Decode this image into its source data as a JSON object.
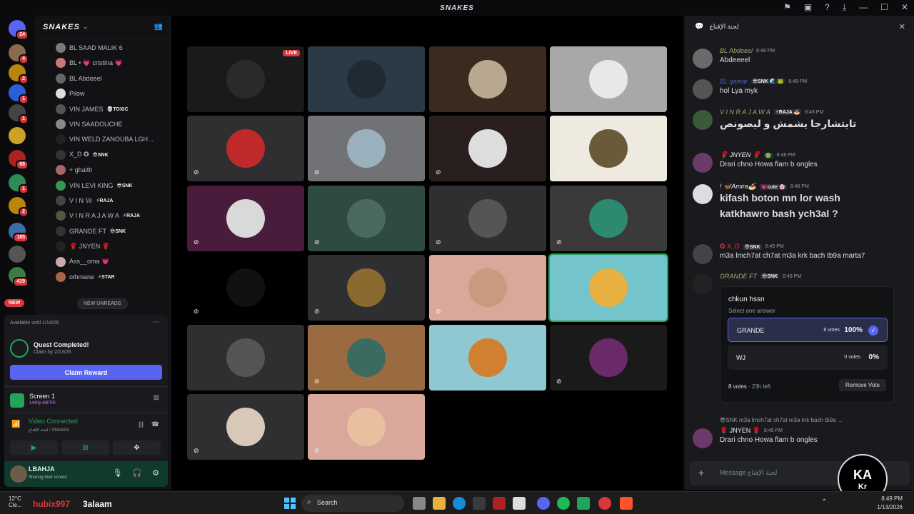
{
  "window": {
    "title": "SNAKES",
    "controls": [
      "flag-icon",
      "inbox-icon",
      "help-icon",
      "download-icon",
      "minimize-icon",
      "maximize-icon",
      "close-icon"
    ]
  },
  "rail": {
    "servers": [
      {
        "badge": "24",
        "color": "#5865f2"
      },
      {
        "badge": "4",
        "color": "#8a6b4f"
      },
      {
        "badge": "2",
        "color": "#b8860b"
      },
      {
        "badge": "1",
        "color": "#2b5fd9"
      },
      {
        "badge": "1",
        "color": "#444444"
      },
      {
        "badge": "",
        "color": "#c9a227"
      },
      {
        "badge": "68",
        "color": "#aa2222"
      },
      {
        "badge": "1",
        "color": "#2e8b57"
      },
      {
        "badge": "2",
        "color": "#b8860b"
      },
      {
        "badge": "185",
        "color": "#3a6ea5"
      },
      {
        "badge": "",
        "color": "#555555"
      },
      {
        "badge": "419",
        "color": "#3a7d44"
      }
    ],
    "new_label": "NEW"
  },
  "sidebar": {
    "server_name": "SNAKES",
    "members": [
      {
        "name": "BL SAAD MALIK 6",
        "tag": "",
        "color": "#7a7a7a"
      },
      {
        "name": "BL • 💗 cristina 💗",
        "tag": "",
        "color": "#c77"
      },
      {
        "name": "BL Abdeeel",
        "tag": "",
        "color": "#666"
      },
      {
        "name": "Pilow",
        "tag": "",
        "color": "#ddd"
      },
      {
        "name": "VIN JAMES",
        "tag": "💀TOXIC",
        "color": "#555"
      },
      {
        "name": "VIN SAADOUCHE",
        "tag": "",
        "color": "#888"
      },
      {
        "name": "VIN WELD ZANOUBA LGH...",
        "tag": "",
        "color": "#222"
      },
      {
        "name": "X_D ✪",
        "tag": "😎SNK",
        "color": "#333"
      },
      {
        "name": "+ ghaith",
        "tag": "",
        "color": "#a66"
      },
      {
        "name": "VIN LEVI KING",
        "tag": "😎SNK",
        "color": "#395"
      },
      {
        "name": "V I N 𝕎",
        "tag": "⚡RAJA",
        "color": "#444"
      },
      {
        "name": "V I N R A J A W A",
        "tag": "⚡RAJA",
        "color": "#554"
      },
      {
        "name": "GRANDE FT",
        "tag": "😎SNK",
        "color": "#333"
      },
      {
        "name": "🌹 JNYEN 🌹",
        "tag": "",
        "color": "#222"
      },
      {
        "name": "Ass__oma 💗",
        "tag": "",
        "color": "#caa"
      },
      {
        "name": "othmane",
        "tag": "⚡STAR",
        "color": "#a64"
      }
    ],
    "new_unreads": "NEW UNREADS",
    "quest": {
      "available": "Available until 1/14/26",
      "title": "Quest Completed!",
      "claim_by": "Claim by 2/13/26",
      "button": "Claim Reward"
    },
    "stream": {
      "name": "Screen 1",
      "quality": "1440p 60FPS"
    },
    "voice": {
      "status": "Video Connected",
      "channel": "لجنة الإقناع / SNAKES"
    },
    "user": {
      "name": "LBAHJA",
      "status": "Sharing their screen"
    }
  },
  "stage": {
    "live_label": "LIVE",
    "tiles": [
      {
        "bg": "#1a1a1a",
        "face": "#2a2a2a",
        "muted": false,
        "live": true
      },
      {
        "bg": "#2b3a45",
        "face": "#1f2a33",
        "muted": false,
        "live": false
      },
      {
        "bg": "#3a2a20",
        "face": "#b8a890",
        "muted": false,
        "live": false
      },
      {
        "bg": "#a8a8a8",
        "face": "#e8e8e8",
        "muted": false,
        "live": false
      },
      {
        "bg": "#2f2f31",
        "face": "#c02a2a",
        "muted": true,
        "live": false
      },
      {
        "bg": "#717276",
        "face": "#9bb0bd",
        "muted": true,
        "live": false
      },
      {
        "bg": "#2a1f1f",
        "face": "#dddddd",
        "muted": true,
        "live": false
      },
      {
        "bg": "#efeae0",
        "face": "#6b5a3a",
        "muted": true,
        "live": false
      },
      {
        "bg": "#4a1c3c",
        "face": "#d9d9d9",
        "muted": true,
        "live": false
      },
      {
        "bg": "#2f4a40",
        "face": "#4a6a60",
        "muted": true,
        "live": false
      },
      {
        "bg": "#2f2f31",
        "face": "#555555",
        "muted": true,
        "live": false
      },
      {
        "bg": "#3a3a3a",
        "face": "#2d8a70",
        "muted": true,
        "live": false
      },
      {
        "bg": "#000000",
        "face": "#111111",
        "muted": true,
        "live": false
      },
      {
        "bg": "#2f2f31",
        "face": "#8a6a30",
        "muted": true,
        "live": false
      },
      {
        "bg": "#d9a89a",
        "face": "#c89a80",
        "muted": true,
        "live": false
      },
      {
        "bg": "#74c4cc",
        "face": "#e8b040",
        "muted": false,
        "live": false
      },
      {
        "bg": "#2f2f31",
        "face": "#555555",
        "muted": false,
        "live": false
      },
      {
        "bg": "#9a6a40",
        "face": "#3a6a60",
        "muted": true,
        "live": false
      },
      {
        "bg": "#8fc8d0",
        "face": "#d08030",
        "muted": false,
        "live": false
      },
      {
        "bg": "#1a1a1a",
        "face": "#6a2a6a",
        "muted": true,
        "live": false
      },
      {
        "bg": "#2f2f31",
        "face": "#d8c8b8",
        "muted": true,
        "live": false
      },
      {
        "bg": "#d9a89a",
        "face": "#e8c0a0",
        "muted": true,
        "live": false
      }
    ]
  },
  "chat": {
    "title": "لجنة الإقناع",
    "messages": [
      {
        "author": "BL Abdeeel",
        "author_color": "#a3a670",
        "tag": "",
        "time": "8:48 PM",
        "text": "Abdeeeel",
        "avatar": "#6a6a6a",
        "big": false
      },
      {
        "author": "BL qamar",
        "author_color": "#4f5fbf",
        "tag": "😎SNK 🌊 🐸",
        "time": "8:48 PM",
        "text": "hol Lya myk",
        "avatar": "#555",
        "big": false
      },
      {
        "author": "V I N R A J A W A",
        "author_color": "#a3a670",
        "tag": "⚡RAJA 🍝",
        "time": "8:48 PM",
        "text": "تايتشارجا يشمش و ليصونص",
        "avatar": "#3a5a3a",
        "big": true
      },
      {
        "author": "🌹 JNYEN 🌹",
        "author_color": "#f2f3f5",
        "tag": "🟢",
        "time": "8:48 PM",
        "text": "Drari chno Howa flam b ongles",
        "avatar": "#6a3a6a",
        "big": false
      },
      {
        "author": "! 🦋Amira🍝",
        "author_color": "#f2f3f5",
        "tag": "💗cute 🌸",
        "time": "8:48 PM",
        "text": "kifash boton mn lor wash",
        "text2": "katkhawro bash ych3al ?",
        "avatar": "#ddd",
        "big": true
      },
      {
        "author": "✪ X_D",
        "author_color": "#da373c",
        "tag": "😎SNK",
        "time": "8:49 PM",
        "text": "m3a lmch7at ch7at m3a krk bach tb9a marta7",
        "avatar": "#444",
        "big": false
      },
      {
        "author": "GRANDE FT",
        "author_color": "#a3a670",
        "tag": "😎SNK",
        "time": "8:49 PM",
        "text": "",
        "avatar": "#222",
        "big": false
      }
    ],
    "poll": {
      "question": "chkun hssn",
      "instruction": "Select one answer",
      "options": [
        {
          "label": "GRANDE",
          "votes": "8 votes",
          "percent": "100%",
          "fill": 1.0,
          "selected": true
        },
        {
          "label": "WJ",
          "votes": "0 votes",
          "percent": "0%",
          "fill": 0.0,
          "selected": false
        }
      ],
      "total": "8 votes",
      "time_left": "23h left",
      "remove": "Remove Vote"
    },
    "reply_preview": "😎SNK m3a lmch7at ch7at m3a krk bach tb9a ...",
    "last": {
      "author": "🌹 JNYEN 🌹",
      "time": "8:49 PM",
      "text": "Drari chno Howa flam b ongles"
    },
    "composer_placeholder": "Message لجنة الإقناع"
  },
  "logo": {
    "mark": "KA",
    "sub": "Kr"
  },
  "taskbar": {
    "weather_temp": "12°C",
    "weather_desc": "Cle...",
    "overlay_red": "hubix997",
    "overlay_white": "3alaam",
    "search": "Search",
    "time": "8:49 PM",
    "date": "1/13/2026"
  }
}
